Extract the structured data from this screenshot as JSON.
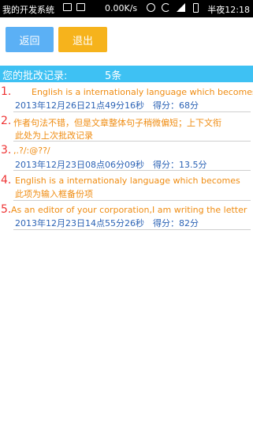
{
  "status_bar": {
    "app_name": "我的开发系统",
    "net_speed": "0.00K/s",
    "clock": "半夜12:18"
  },
  "toolbar": {
    "back_label": "返回",
    "exit_label": "退出"
  },
  "header": {
    "title": "您的批改记录:",
    "count": "5条"
  },
  "records": [
    {
      "num": "1.",
      "content": "English is a internationaly language which becomes",
      "meta": "2013年12月26日21点49分16秒　得分：68分"
    },
    {
      "num": "2.",
      "content_line1": "作者句法不错，但是文章整体句子稍微偏短；上下文衔",
      "content_line2": "此处为上次批改记录"
    },
    {
      "num": "3.",
      "content": ",.?/:@??/",
      "meta": "2013年12月23日08点06分09秒　得分：13.5分"
    },
    {
      "num": "4.",
      "content_line1": "English is a internationaly language which becomes",
      "content_line2": "此项为输入框备份项"
    },
    {
      "num": "5.",
      "content": "As an editor of your corporation,I am writing the letter",
      "meta": "2013年12月23日14点55分26秒　得分：82分"
    }
  ]
}
